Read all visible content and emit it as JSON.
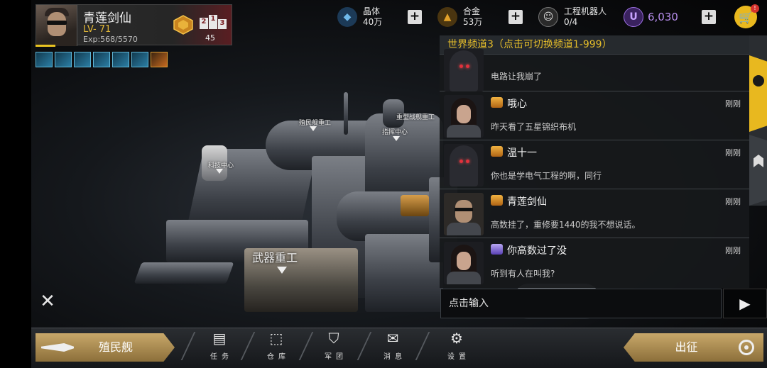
{
  "player": {
    "name": "青莲剑仙",
    "level": "LV- 71",
    "exp": "Exp:568/5570",
    "rank_digits": [
      "2",
      "1",
      "3"
    ],
    "rank_count": "45",
    "exp_progress": 0.102
  },
  "resources": {
    "crystal": {
      "label": "晶体",
      "value": "40万",
      "icon": "crystal-icon"
    },
    "alloy": {
      "label": "合金",
      "value": "53万",
      "icon": "alloy-icon"
    },
    "robots": {
      "label": "工程机器人",
      "value": "0/4",
      "icon": "robot-icon"
    },
    "currency": {
      "symbol": "U",
      "value": "6,030"
    },
    "plus": "+"
  },
  "shop": {
    "icon": "cart-icon",
    "badge": "!"
  },
  "chat": {
    "channel": "世界频道3（点击可切换频道1-999）",
    "messages": [
      {
        "sender": "",
        "text": "电路让我崩了",
        "time": "",
        "avatar": "hooded-red-eyes"
      },
      {
        "sender": "哦心",
        "text": "昨天看了五星锦织布机",
        "time": "刚刚",
        "avatar": "girl"
      },
      {
        "sender": "温十一",
        "text": "你也是学电气工程的啊，同行",
        "time": "刚刚",
        "avatar": "hooded-red-eyes"
      },
      {
        "sender": "青莲剑仙",
        "text": "高数挂了，重修要1440的我不想说话。",
        "time": "刚刚",
        "avatar": "man-glasses"
      },
      {
        "sender": "你高数过了没",
        "text": "听到有人在叫我?",
        "time": "刚刚",
        "avatar": "girl"
      }
    ],
    "input_placeholder": "点击输入",
    "send_icon": "▶"
  },
  "station_labels": {
    "colony_heavy": "殖民舰重工",
    "heavy_battleship": "重型战舰重工",
    "command": "指挥中心",
    "tech": "科技中心",
    "weapons": "武器重工"
  },
  "bottom": {
    "colony_ship": "殖民舰",
    "expedition": "出征",
    "nav": [
      {
        "label": "任务",
        "icon": "task-icon"
      },
      {
        "label": "仓库",
        "icon": "warehouse-icon"
      },
      {
        "label": "军团",
        "icon": "legion-icon"
      },
      {
        "label": "消息",
        "icon": "message-icon"
      },
      {
        "label": "设置",
        "icon": "settings-icon"
      }
    ]
  },
  "colors": {
    "gold": "#e8b81f",
    "chat_channel": "#e5bd2a",
    "currency_purple": "#b98ff0"
  }
}
